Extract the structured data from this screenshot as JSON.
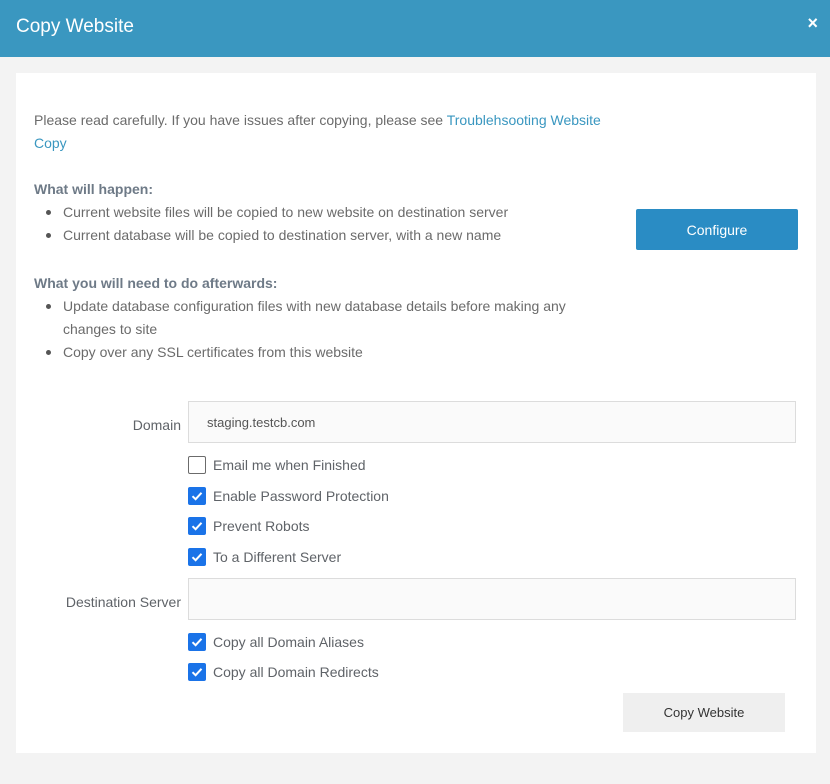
{
  "dialog": {
    "title": "Copy Website",
    "close_label": "×"
  },
  "intro": {
    "text": "Please read carefully. If you have issues after copying, please see ",
    "link_text": "Troublehsooting Website Copy"
  },
  "what_will_happen": {
    "title": "What will happen:",
    "items": [
      "Current website files will be copied to new website on destination server",
      "Current database will be copied to destination server, with a new name"
    ]
  },
  "afterwards": {
    "title": "What you will need to do afterwards:",
    "items": [
      "Update database configuration files with new database details before making any changes to site",
      "Copy over any SSL certificates from this website"
    ]
  },
  "configure_button": "Configure",
  "form": {
    "domain_label": "Domain",
    "domain_value": "staging.testcb.com",
    "checkboxes_top": [
      {
        "label": "Email me when Finished",
        "checked": false
      },
      {
        "label": "Enable Password Protection",
        "checked": true
      },
      {
        "label": "Prevent Robots",
        "checked": true
      },
      {
        "label": "To a Different Server",
        "checked": true
      }
    ],
    "destination_label": "Destination Server",
    "destination_value": "",
    "checkboxes_bottom": [
      {
        "label": "Copy all Domain Aliases",
        "checked": true
      },
      {
        "label": "Copy all Domain Redirects",
        "checked": true
      }
    ]
  },
  "copy_button": "Copy Website",
  "colors": {
    "header": "#3a97c0",
    "primary_button": "#2a8cc4",
    "checkbox": "#1a73e8",
    "link": "#3a97c0"
  }
}
